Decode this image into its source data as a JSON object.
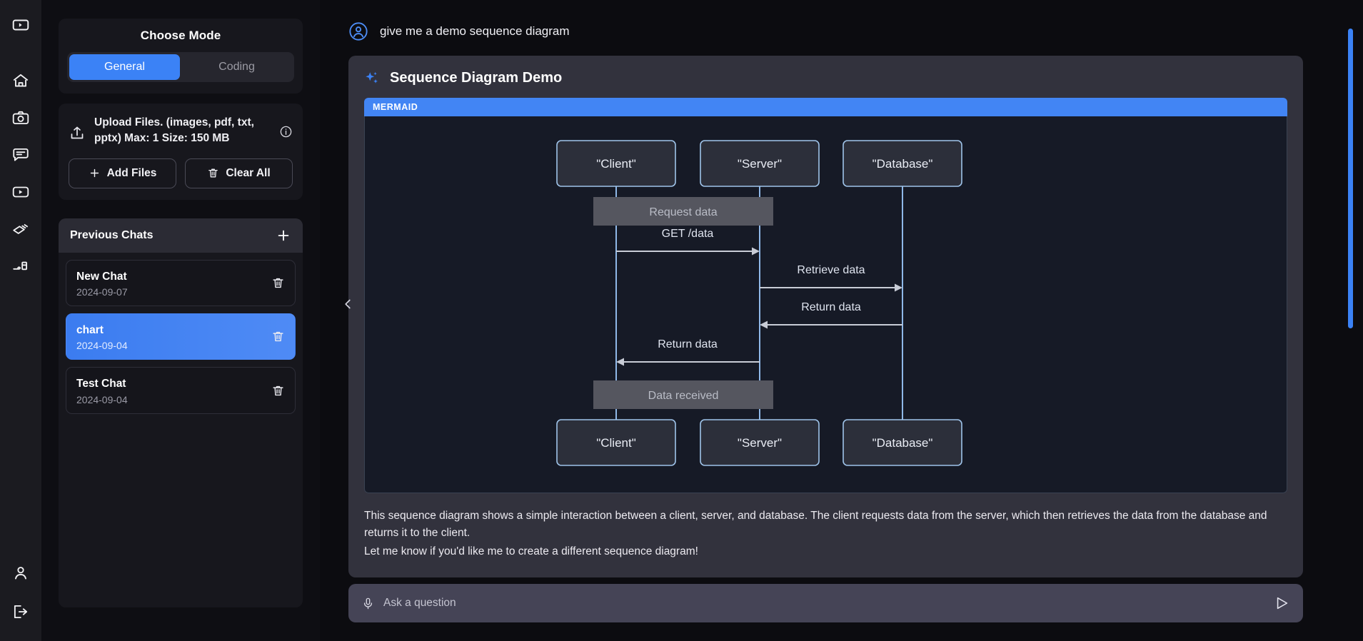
{
  "rail": {
    "top_icon": "panel-expand-icon",
    "items": [
      {
        "name": "home-icon"
      },
      {
        "name": "camera-icon"
      },
      {
        "name": "chat-bubble-icon"
      },
      {
        "name": "video-icon"
      },
      {
        "name": "cards-icon"
      },
      {
        "name": "pen-write-icon"
      }
    ],
    "bottom": [
      {
        "name": "user-icon"
      },
      {
        "name": "logout-icon"
      }
    ]
  },
  "sidebar": {
    "mode": {
      "title": "Choose Mode",
      "options": [
        {
          "label": "General",
          "selected": true
        },
        {
          "label": "Coding",
          "selected": false
        }
      ]
    },
    "upload": {
      "text": "Upload Files. (images, pdf, txt, pptx) Max: 1 Size: 150 MB",
      "icon": "upload-icon",
      "info_icon": "info-icon",
      "add_files_label": "Add Files",
      "clear_all_label": "Clear All"
    },
    "chats": {
      "title": "Previous Chats",
      "add_label": "+",
      "items": [
        {
          "name": "New Chat",
          "date": "2024-09-07",
          "selected": false
        },
        {
          "name": "chart",
          "date": "2024-09-04",
          "selected": true
        },
        {
          "name": "Test Chat",
          "date": "2024-09-04",
          "selected": false
        }
      ]
    },
    "collapse_icon": "chevron-left-icon"
  },
  "conversation": {
    "user_message": "give me a demo sequence diagram",
    "answer_title": "Sequence Diagram Demo",
    "code_language": "MERMAID",
    "explanation_line1": "This sequence diagram shows a simple interaction between a client, server, and database. The client requests data from the server, which then retrieves the data from the database and returns it to the client.",
    "explanation_line2": "Let me know if you'd like me to create a different sequence diagram!"
  },
  "diagram": {
    "type": "sequence",
    "participants": [
      "\"Client\"",
      "\"Server\"",
      "\"Database\""
    ],
    "notes": [
      {
        "text": "Request data",
        "over": [
          "\"Client\"",
          "\"Server\""
        ]
      },
      {
        "text": "Data received",
        "over": [
          "\"Client\"",
          "\"Server\""
        ]
      }
    ],
    "messages": [
      {
        "from": "\"Client\"",
        "to": "\"Server\"",
        "label": "GET /data",
        "direction": "right"
      },
      {
        "from": "\"Server\"",
        "to": "\"Database\"",
        "label": "Retrieve data",
        "direction": "right"
      },
      {
        "from": "\"Database\"",
        "to": "\"Server\"",
        "label": "Return data",
        "direction": "left"
      },
      {
        "from": "\"Server\"",
        "to": "\"Client\"",
        "label": "Return data",
        "direction": "left"
      }
    ]
  },
  "composer": {
    "placeholder": "Ask a question",
    "value": "",
    "mic_icon": "microphone-icon",
    "send_icon": "send-icon"
  },
  "colors": {
    "accent": "#3b82f6",
    "code_bar": "#4285f4",
    "answer_bg": "#32323d",
    "diagram_bg": "#161a26"
  }
}
